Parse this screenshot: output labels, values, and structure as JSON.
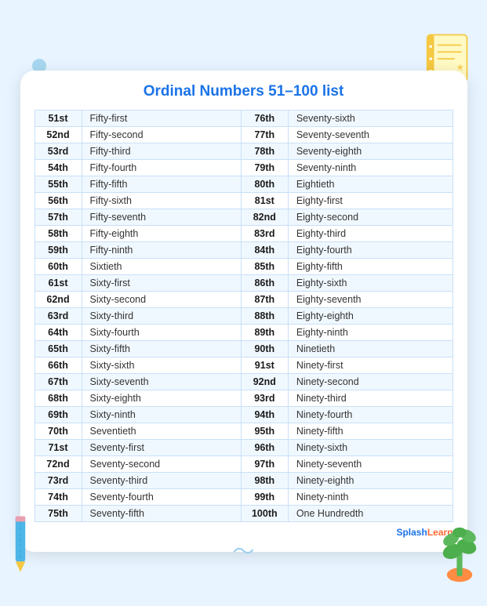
{
  "title": "Ordinal Numbers 51–100 list",
  "rows": [
    [
      "51st",
      "Fifty-first",
      "76th",
      "Seventy-sixth"
    ],
    [
      "52nd",
      "Fifty-second",
      "77th",
      "Seventy-seventh"
    ],
    [
      "53rd",
      "Fifty-third",
      "78th",
      "Seventy-eighth"
    ],
    [
      "54th",
      "Fifty-fourth",
      "79th",
      "Seventy-ninth"
    ],
    [
      "55th",
      "Fifty-fifth",
      "80th",
      "Eightieth"
    ],
    [
      "56th",
      "Fifty-sixth",
      "81st",
      "Eighty-first"
    ],
    [
      "57th",
      "Fifty-seventh",
      "82nd",
      "Eighty-second"
    ],
    [
      "58th",
      "Fifty-eighth",
      "83rd",
      "Eighty-third"
    ],
    [
      "59th",
      "Fifty-ninth",
      "84th",
      "Eighty-fourth"
    ],
    [
      "60th",
      "Sixtieth",
      "85th",
      "Eighty-fifth"
    ],
    [
      "61st",
      "Sixty-first",
      "86th",
      "Eighty-sixth"
    ],
    [
      "62nd",
      "Sixty-second",
      "87th",
      "Eighty-seventh"
    ],
    [
      "63rd",
      "Sixty-third",
      "88th",
      "Eighty-eighth"
    ],
    [
      "64th",
      "Sixty-fourth",
      "89th",
      "Eighty-ninth"
    ],
    [
      "65th",
      "Sixty-fifth",
      "90th",
      "Ninetieth"
    ],
    [
      "66th",
      "Sixty-sixth",
      "91st",
      "Ninety-first"
    ],
    [
      "67th",
      "Sixty-seventh",
      "92nd",
      "Ninety-second"
    ],
    [
      "68th",
      "Sixty-eighth",
      "93rd",
      "Ninety-third"
    ],
    [
      "69th",
      "Sixty-ninth",
      "94th",
      "Ninety-fourth"
    ],
    [
      "70th",
      "Seventieth",
      "95th",
      "Ninety-fifth"
    ],
    [
      "71st",
      "Seventy-first",
      "96th",
      "Ninety-sixth"
    ],
    [
      "72nd",
      "Seventy-second",
      "97th",
      "Ninety-seventh"
    ],
    [
      "73rd",
      "Seventy-third",
      "98th",
      "Ninety-eighth"
    ],
    [
      "74th",
      "Seventy-fourth",
      "99th",
      "Ninety-ninth"
    ],
    [
      "75th",
      "Seventy-fifth",
      "100th",
      "One Hundredth"
    ]
  ],
  "logo": {
    "splash": "Splash",
    "learn": "Learn"
  }
}
